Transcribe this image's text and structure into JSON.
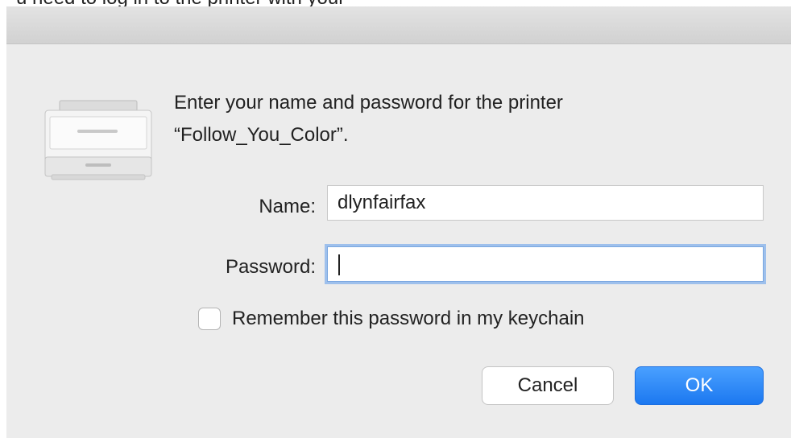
{
  "top_fragment": "u need to log in to the printer with your",
  "dialog": {
    "prompt_line1": "Enter your name and password for the printer",
    "prompt_line2": "“Follow_You_Color”.",
    "name_label": "Name:",
    "name_value": "dlynfairfax",
    "password_label": "Password:",
    "password_value": "",
    "remember_label": "Remember this password in my keychain",
    "remember_checked": false,
    "cancel_label": "Cancel",
    "ok_label": "OK"
  },
  "colors": {
    "dialog_bg": "#ececec",
    "ok_button": "#1c78f0",
    "focus_ring": "#9ec0ec"
  },
  "icons": {
    "printer": "printer-icon"
  }
}
